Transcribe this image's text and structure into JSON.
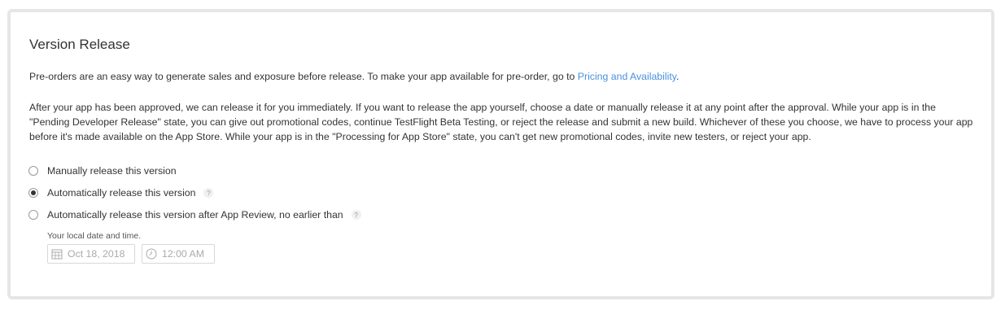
{
  "section": {
    "title": "Version Release",
    "intro_text": "Pre-orders are an easy way to generate sales and exposure before release. To make your app available for pre-order, go to ",
    "intro_link": "Pricing and Availability",
    "intro_end": ".",
    "body_text": "After your app has been approved, we can release it for you immediately. If you want to release the app yourself, choose a date or manually release it at any point after the approval. While your app is in the \"Pending Developer Release\" state, you can give out promotional codes, continue TestFlight Beta Testing, or reject the release and submit a new build. Whichever of these you choose, we have to process your app before it's made available on the App Store. While your app is in the \"Processing for App Store\" state, you can't get new promotional codes, invite new testers, or reject your app."
  },
  "options": [
    {
      "label": "Manually release this version",
      "checked": false,
      "help": false
    },
    {
      "label": "Automatically release this version",
      "checked": true,
      "help": true
    },
    {
      "label": "Automatically release this version after App Review, no earlier than",
      "checked": false,
      "help": true
    }
  ],
  "help_glyph": "?",
  "schedule": {
    "local_label": "Your local date and time.",
    "date_value": "Oct 18, 2018",
    "time_value": "12:00 AM",
    "date_icon": "calendar-icon",
    "time_icon": "clock-icon"
  }
}
